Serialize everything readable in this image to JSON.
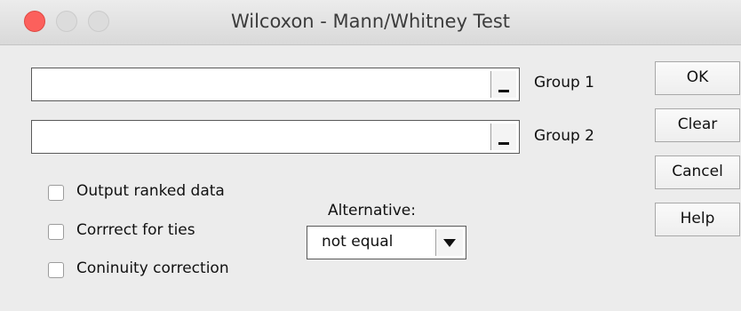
{
  "window": {
    "title": "Wilcoxon - Mann/Whitney Test"
  },
  "fields": [
    {
      "label": "Group 1",
      "value": ""
    },
    {
      "label": "Group 2",
      "value": ""
    }
  ],
  "buttons": {
    "ok": "OK",
    "clear": "Clear",
    "cancel": "Cancel",
    "help": "Help"
  },
  "options": [
    {
      "label": "Output ranked data",
      "checked": false
    },
    {
      "label": "Corrrect for ties",
      "checked": false
    },
    {
      "label": "Coninuity correction",
      "checked": false
    }
  ],
  "alternative": {
    "label": "Alternative:",
    "selected": "not equal"
  },
  "colors": {
    "close": "#fc605c",
    "background": "#ececec"
  }
}
